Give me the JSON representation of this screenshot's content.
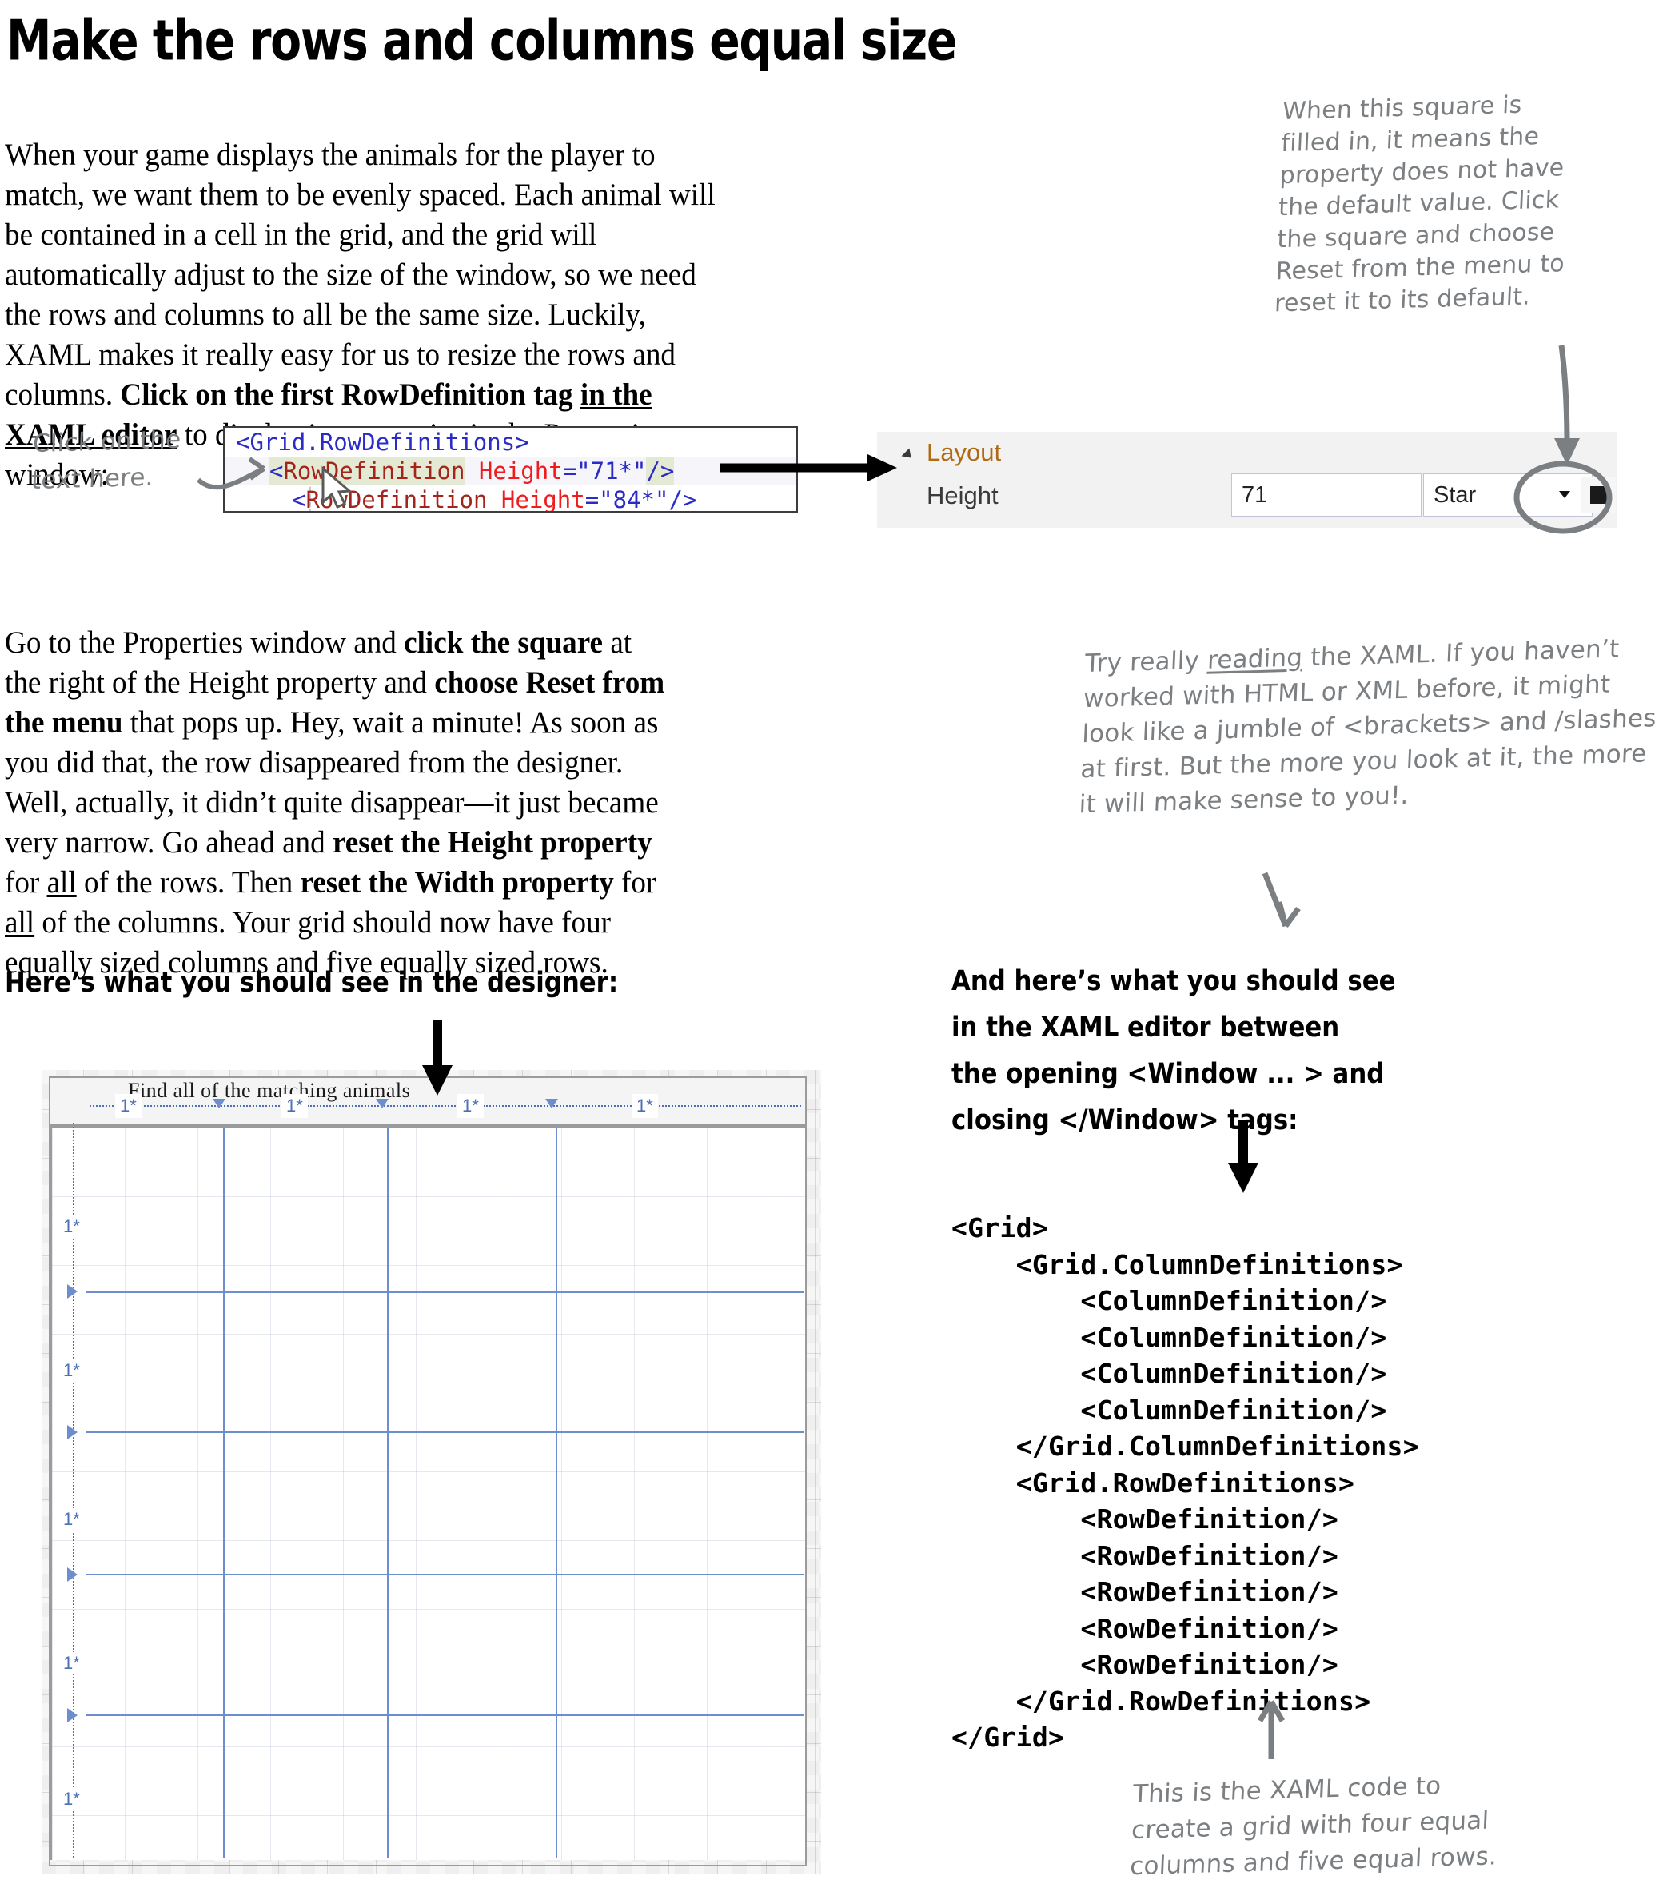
{
  "page": {
    "title": "Make the rows and columns equal size"
  },
  "paragraphs": {
    "intro_html": "When your game displays the animals for the player to match, we want them to be evenly spaced. Each animal will be contained in a cell in the grid, and the grid will automatically adjust to the size of the window, so we need the rows and columns to all be the same size. Luckily, XAML makes it really easy for us to resize the rows and columns. <b>Click on the first RowDefinition tag <u>in the XAML editor</u></b> to display its properties in the Properties window:",
    "second_html": "Go to the Properties window and <b>click the square</b> at the right of the Height property and <b>choose Reset from the menu</b> that pops up. Hey, wait a minute! As soon as you did that, the row disappeared from the designer. Well, actually, it didn&rsquo;t quite disappear&mdash;it just became very narrow. Go ahead and <b>reset the Height property</b> for <u>all</u> of the rows. Then <b>reset the Width property</b> for <u>all</u> of the columns. Your grid should now have four equally sized columns and five equally sized rows."
  },
  "annotations": {
    "click_text_here": "Click on the\ntext here.",
    "square_filled": "When this square is\nfilled in, it means the\nproperty does not have\nthe default value. Click\nthe square and choose\nReset from the menu to\nreset it to its default.",
    "try_reading_html": "Try really <span class=\"ul\">reading</span> the XAML. If you haven&rsquo;t worked with HTML or XML before, it might look like a jumble of &lt;brackets&gt; and /slashes at first. But the more you look at it, the more it will make sense to you!.",
    "bottom_caption": "This is the XAML code to\ncreate a grid with four equal\ncolumns and five equal rows."
  },
  "headings": {
    "designer": "Here’s what you should see in the designer:",
    "xaml_editor": "And here’s what you should see\nin the XAML editor between\nthe opening <Window ... > and\nclosing </Window> tags:"
  },
  "xaml_editor": {
    "line1": "<Grid.RowDefinitions>",
    "line2": {
      "open_bracket": "<",
      "element": "RowDefinition",
      "attribute": "Height",
      "equals": "=",
      "value": "\"71*\"",
      "close": "/>"
    },
    "line3": {
      "open_bracket": "<",
      "element": "RowDefinition",
      "attribute": "Height",
      "equals": "=",
      "value": "\"84*\"",
      "close": "/>"
    },
    "cursor_icon": "mouse-pointer-icon"
  },
  "properties_window": {
    "section_label": "Layout",
    "expander_icon": "triangle-expanded-icon",
    "property_label": "Height",
    "value_field": "71",
    "unit_select": "Star",
    "unit_caret_icon": "chevron-down-icon",
    "default_marker_icon": "filled-square-icon"
  },
  "xaml_code": {
    "lines": [
      "<Grid>",
      "    <Grid.ColumnDefinitions>",
      "        <ColumnDefinition/>",
      "        <ColumnDefinition/>",
      "        <ColumnDefinition/>",
      "        <ColumnDefinition/>",
      "    </Grid.ColumnDefinitions>",
      "    <Grid.RowDefinitions>",
      "        <RowDefinition/>",
      "        <RowDefinition/>",
      "        <RowDefinition/>",
      "        <RowDefinition/>",
      "        <RowDefinition/>",
      "    </Grid.RowDefinitions>",
      "</Grid>"
    ]
  },
  "designer": {
    "window_title": "Find all of the matching animals",
    "column_markers": [
      "1*",
      "1*",
      "1*",
      "1*"
    ],
    "row_markers": [
      "1*",
      "1*",
      "1*",
      "1*",
      "1*"
    ],
    "column_count": 4,
    "row_count": 5
  },
  "colors": {
    "hand_ink": "#7b7f82",
    "xaml_bracket": "#2b2bc8",
    "xaml_element": "#a3241a",
    "xaml_attribute": "#ee1c1c",
    "xaml_value": "#2b2bc8",
    "selection_highlight": "#e4e9d4",
    "props_section": "#b06a14",
    "designer_guide": "#6d8ece"
  }
}
